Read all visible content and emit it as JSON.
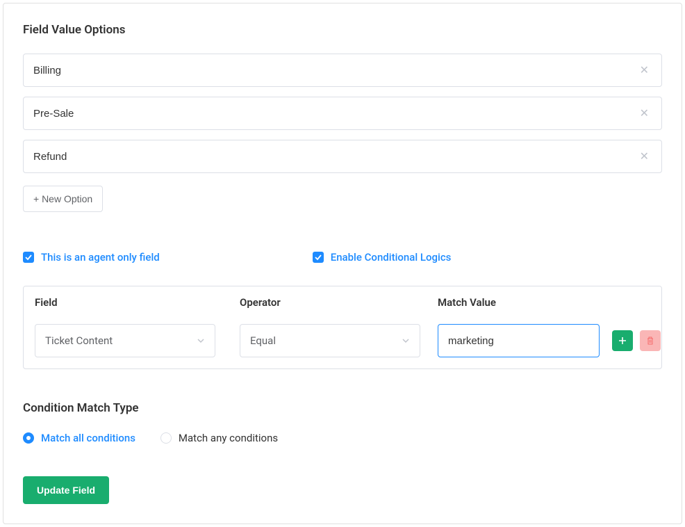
{
  "sectionTitle": "Field Value Options",
  "options": [
    "Billing",
    "Pre-Sale",
    "Refund"
  ],
  "newOptionLabel": "+ New Option",
  "agentOnlyLabel": "This is an agent only field",
  "enableConditionalLabel": "Enable Conditional Logics",
  "table": {
    "headers": {
      "field": "Field",
      "operator": "Operator",
      "matchValue": "Match Value"
    },
    "row": {
      "field": "Ticket Content",
      "operator": "Equal",
      "matchValue": "marketing"
    }
  },
  "conditionMatchTitle": "Condition Match Type",
  "matchAllLabel": "Match all conditions",
  "matchAnyLabel": "Match any conditions",
  "updateBtnLabel": "Update Field"
}
